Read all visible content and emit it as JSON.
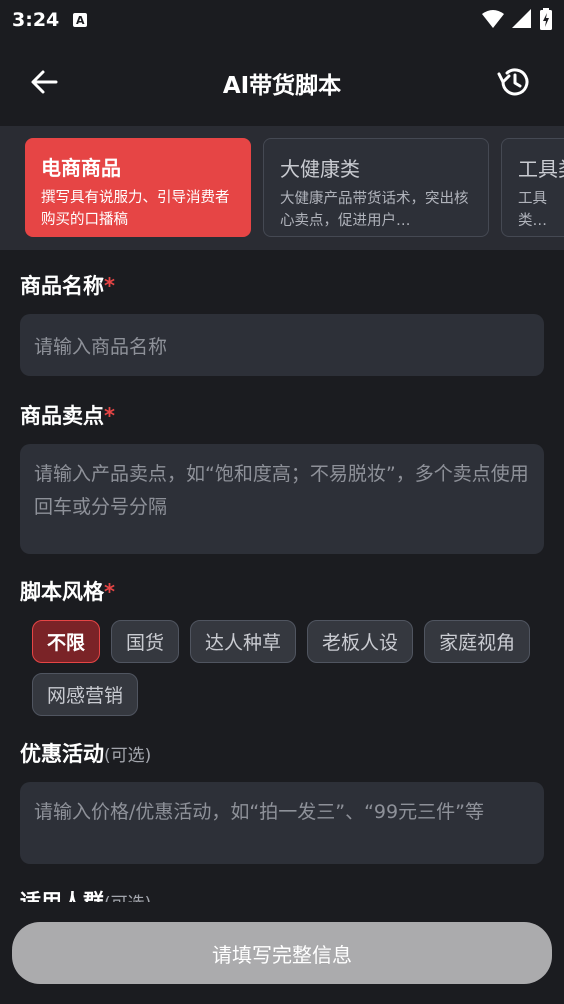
{
  "status_bar": {
    "time": "3:24",
    "a_badge": "A"
  },
  "app_bar": {
    "title": "AI带货脚本"
  },
  "categories": [
    {
      "title": "电商商品",
      "desc": "撰写具有说服力、引导消费者购买的口播稿"
    },
    {
      "title": "大健康类",
      "desc": "大健康产品带货话术，突出核心卖点，促进用户…"
    },
    {
      "title": "工具类",
      "desc": "工具类准传达"
    }
  ],
  "form": {
    "product_name": {
      "label": "商品名称",
      "required": "*",
      "placeholder": "请输入商品名称"
    },
    "selling_points": {
      "label": "商品卖点",
      "required": "*",
      "placeholder": "请输入产品卖点，如“饱和度高；不易脱妆”，多个卖点使用回车或分号分隔"
    },
    "script_style": {
      "label": "脚本风格",
      "required": "*",
      "options": [
        "不限",
        "国货",
        "达人种草",
        "老板人设",
        "家庭视角",
        "网感营销"
      ],
      "selected": "不限"
    },
    "promotion": {
      "label": "优惠活动",
      "optional": "(可选)",
      "placeholder": "请输入价格/优惠活动，如“拍一发三”、“99元三件”等"
    },
    "audience": {
      "label": "适用人群",
      "optional": "(可选)"
    }
  },
  "submit": {
    "label": "请填写完整信息"
  }
}
